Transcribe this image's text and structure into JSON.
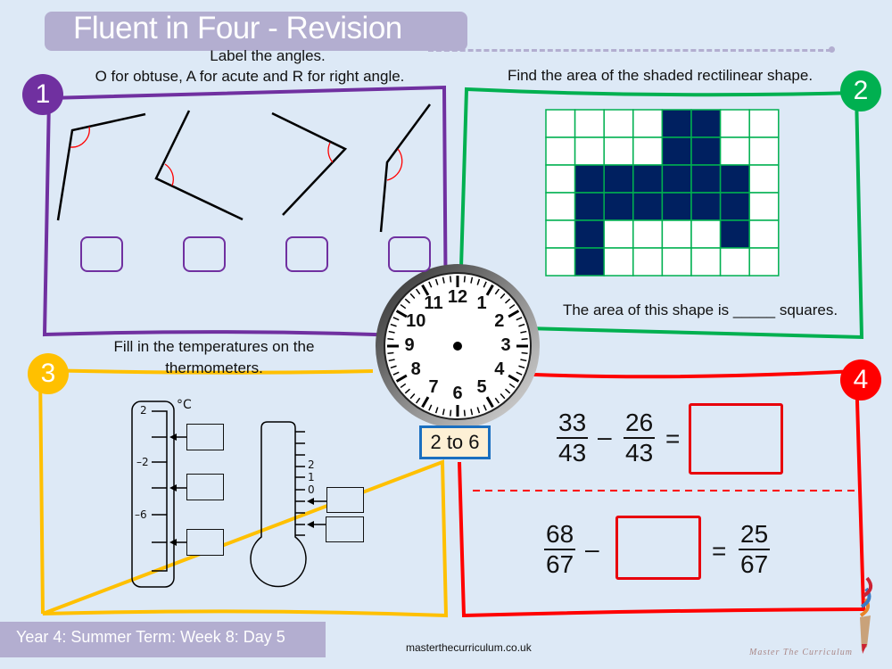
{
  "header": {
    "title": "Fluent in Four - Revision"
  },
  "footer": {
    "lesson": "Year 4: Summer Term: Week 8: Day 5",
    "website": "masterthecurriculum.co.uk",
    "brand": "Master The Curriculum"
  },
  "colors": {
    "q1": "#7030a0",
    "q2": "#00b050",
    "q3": "#ffc000",
    "q4": "#ff0000",
    "title_bar": "#b3aed0",
    "grid_fill": "#002060"
  },
  "q1": {
    "number": "1",
    "instruction_line1": "Label the angles.",
    "instruction_line2": "O for obtuse, A for acute and R for right angle.",
    "answer_boxes": [
      "",
      "",
      "",
      ""
    ]
  },
  "q2": {
    "number": "2",
    "instruction": "Find the area of the shaded rectilinear shape.",
    "grid": [
      [
        0,
        0,
        0,
        0,
        1,
        1,
        0,
        0
      ],
      [
        0,
        0,
        0,
        0,
        1,
        1,
        0,
        0
      ],
      [
        0,
        1,
        1,
        1,
        1,
        1,
        1,
        0
      ],
      [
        0,
        1,
        1,
        1,
        1,
        1,
        1,
        0
      ],
      [
        0,
        1,
        0,
        0,
        0,
        0,
        1,
        0
      ],
      [
        0,
        1,
        0,
        0,
        0,
        0,
        0,
        0
      ]
    ],
    "answer_sentence": "The area of this shape is _____ squares."
  },
  "clock": {
    "numbers": [
      "12",
      "1",
      "2",
      "3",
      "4",
      "5",
      "6",
      "7",
      "8",
      "9",
      "10",
      "11"
    ],
    "label": "2 to 6"
  },
  "q3": {
    "number": "3",
    "instruction_line1": "Fill in the temperatures on the",
    "instruction_line2": "thermometers.",
    "unit": "°C",
    "thermometer1_labels": [
      "2",
      "–2",
      "–6"
    ],
    "thermometer2_labels": [
      "2",
      "1",
      "0"
    ]
  },
  "q4": {
    "number": "4",
    "eq1": {
      "a_num": "33",
      "a_den": "43",
      "op": "–",
      "b_num": "26",
      "b_den": "43",
      "eq": "="
    },
    "eq2": {
      "a_num": "68",
      "a_den": "67",
      "op": "–",
      "eq": "=",
      "c_num": "25",
      "c_den": "67"
    }
  }
}
